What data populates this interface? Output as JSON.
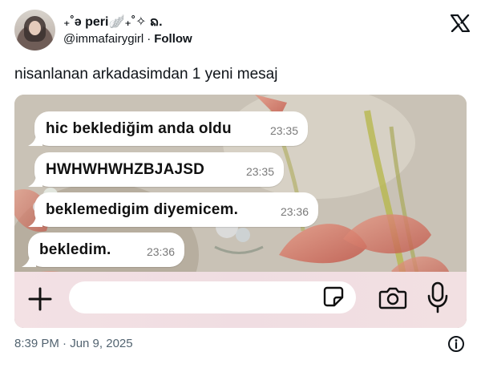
{
  "post": {
    "display_name": "₊˚ə peri🪽₊˚✧ ᨦ.",
    "handle": "@immafairygirl",
    "separator": "·",
    "follow_label": "Follow",
    "text": "nisanlanan arkadasimdan 1 yeni mesaj",
    "timestamp": "8:39 PM · Jun 9, 2025"
  },
  "chat": {
    "messages": [
      {
        "text": "hic beklediğim anda oldu",
        "time": "23:35"
      },
      {
        "text": "HWHWHWHZBJAJSD",
        "time": "23:35"
      },
      {
        "text": "beklemedigim diyemicem.",
        "time": "23:36"
      },
      {
        "text": "bekledim.",
        "time": "23:36"
      }
    ]
  },
  "icons": {
    "x_logo": "x-logo-icon",
    "plus": "plus-icon",
    "sticker": "sticker-icon",
    "camera": "camera-icon",
    "mic": "microphone-icon",
    "info": "info-icon"
  },
  "colors": {
    "text_primary": "#0f1419",
    "text_secondary": "#536471",
    "bubble": "#ffffff",
    "composer": "#f2e0e2"
  }
}
